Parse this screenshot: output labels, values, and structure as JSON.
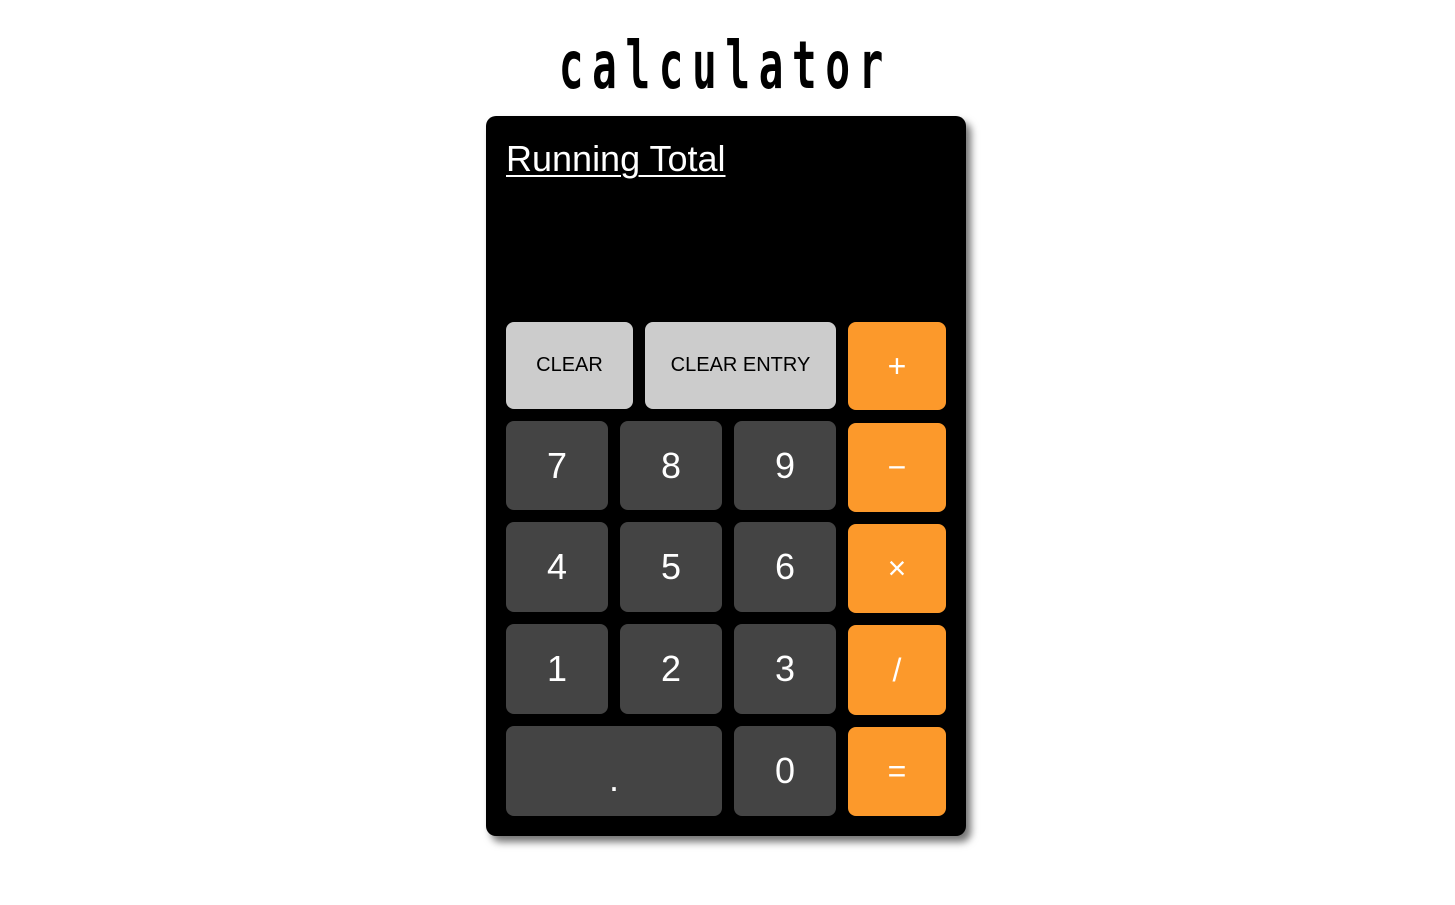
{
  "app": {
    "title": "calculator"
  },
  "display": {
    "label": "Running Total",
    "value": ""
  },
  "buttons": {
    "clear": "CLEAR",
    "clear_entry": "CLEAR ENTRY",
    "plus": "+",
    "minus": "−",
    "times": "×",
    "divide": "/",
    "equals": "=",
    "seven": "7",
    "eight": "8",
    "nine": "9",
    "four": "4",
    "five": "5",
    "six": "6",
    "one": "1",
    "two": "2",
    "three": "3",
    "dot": ".",
    "zero": "0"
  },
  "colors": {
    "operator": "#fc992b",
    "digit": "#444444",
    "function": "#cccccc",
    "body": "#000000"
  }
}
